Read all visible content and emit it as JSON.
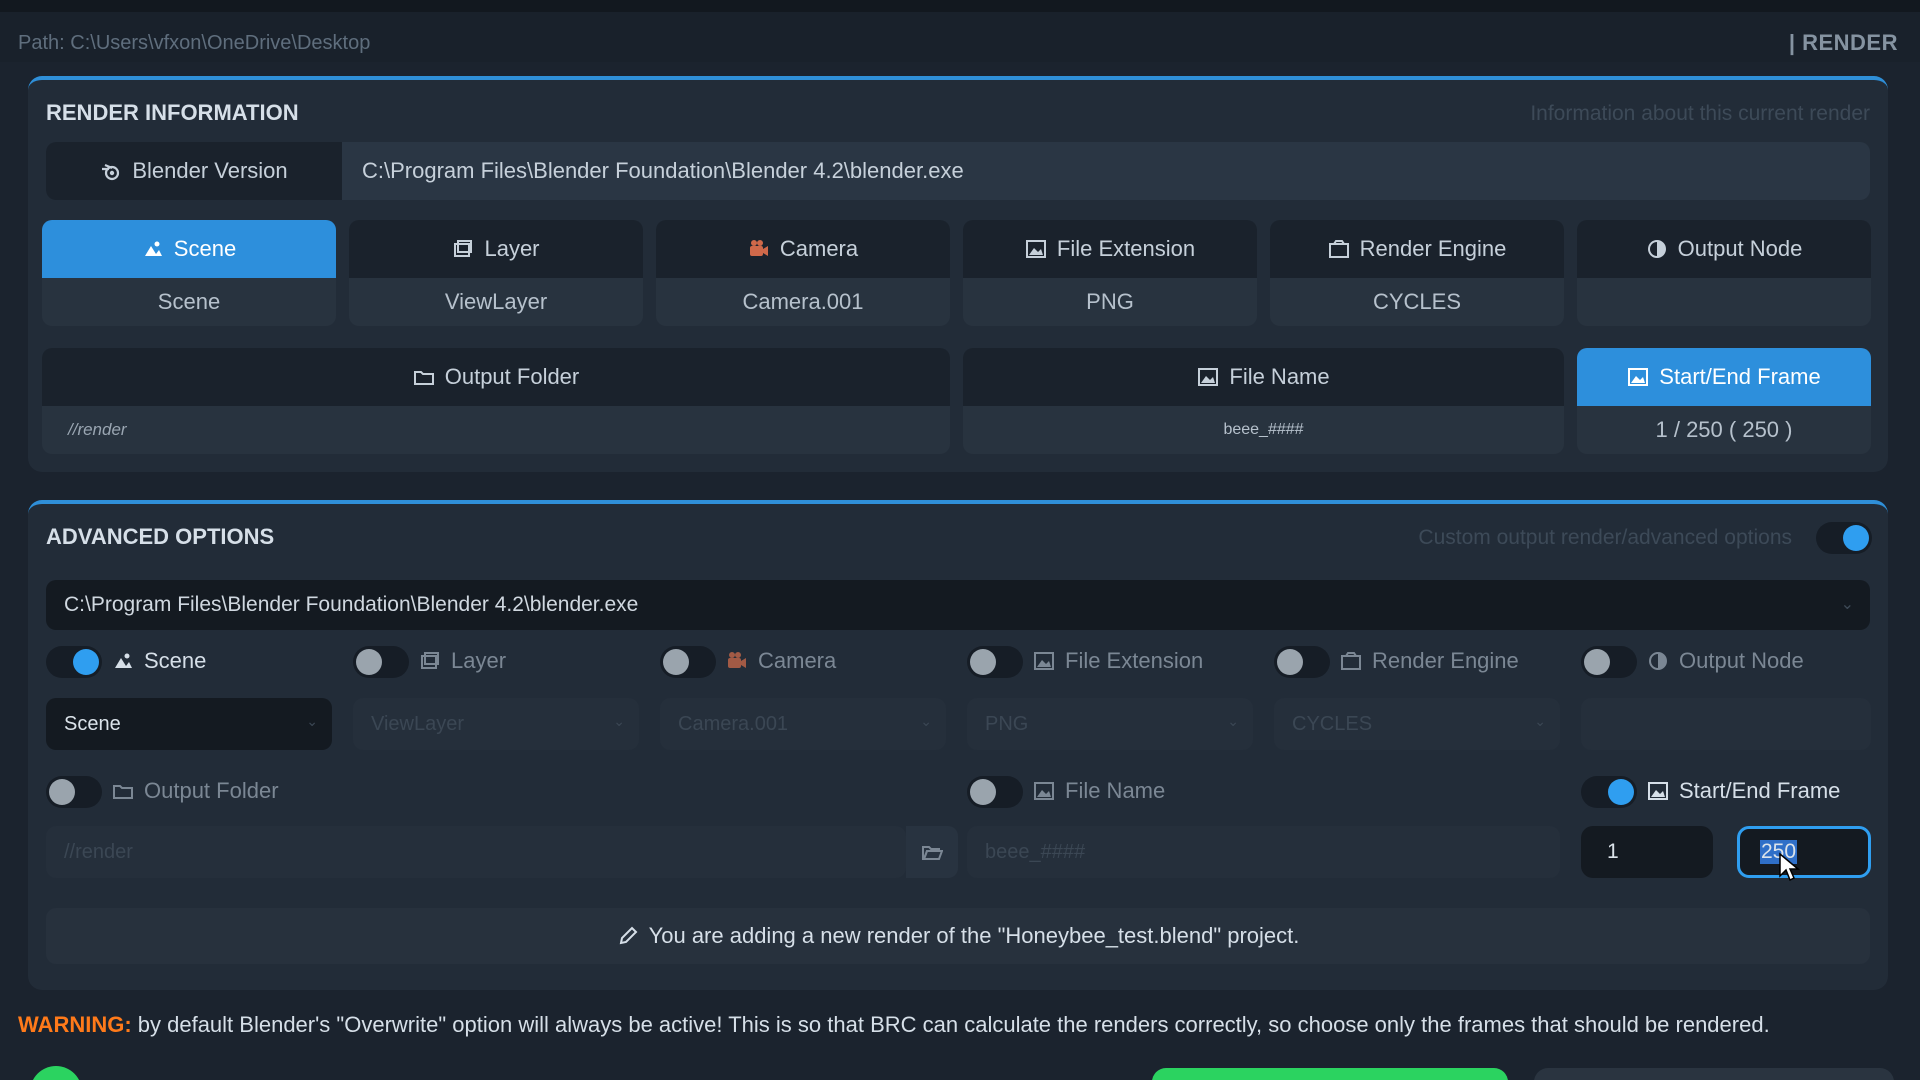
{
  "header": {
    "path": "Path: C:\\Users\\vfxon\\OneDrive\\Desktop",
    "section": "| RENDER"
  },
  "render_info": {
    "title": "RENDER INFORMATION",
    "subtitle": "Information about this current render",
    "version_label": "Blender Version",
    "version_path": "C:\\Program Files\\Blender Foundation\\Blender 4.2\\blender.exe",
    "cards": [
      {
        "label": "Scene",
        "value": "Scene",
        "icon": "scene-icon",
        "active": true
      },
      {
        "label": "Layer",
        "value": "ViewLayer",
        "icon": "layer-icon",
        "active": false
      },
      {
        "label": "Camera",
        "value": "Camera.001",
        "icon": "camera-icon",
        "active": false
      },
      {
        "label": "File Extension",
        "value": "PNG",
        "icon": "image-icon",
        "active": false
      },
      {
        "label": "Render Engine",
        "value": "CYCLES",
        "icon": "render-engine-icon",
        "active": false
      },
      {
        "label": "Output Node",
        "value": "",
        "icon": "output-node-icon",
        "active": false
      }
    ],
    "output_folder": {
      "label": "Output Folder",
      "value": "//render"
    },
    "file_name": {
      "label": "File Name",
      "value": "beee_####"
    },
    "frames": {
      "label": "Start/End Frame",
      "value": "1 / 250 ( 250 )"
    }
  },
  "advanced": {
    "title": "ADVANCED OPTIONS",
    "subtitle": "Custom output render/advanced options",
    "toggle_on": true,
    "blender_path": "C:\\Program Files\\Blender Foundation\\Blender 4.2\\blender.exe",
    "options": [
      {
        "label": "Scene",
        "on": true,
        "value": "Scene"
      },
      {
        "label": "Layer",
        "on": false,
        "value": "ViewLayer"
      },
      {
        "label": "Camera",
        "on": false,
        "value": "Camera.001"
      },
      {
        "label": "File Extension",
        "on": false,
        "value": "PNG"
      },
      {
        "label": "Render Engine",
        "on": false,
        "value": "CYCLES"
      },
      {
        "label": "Output Node",
        "on": false,
        "value": ""
      }
    ],
    "output_folder": {
      "label": "Output Folder",
      "on": false,
      "placeholder": "//render"
    },
    "file_name": {
      "label": "File Name",
      "on": false,
      "placeholder": "beee_####"
    },
    "frames": {
      "label": "Start/End Frame",
      "on": true,
      "start": "1",
      "end": "250"
    },
    "info_message": "You are adding a new render of the \"Honeybee_test.blend\" project."
  },
  "warning": {
    "prefix": "WARNING:",
    "text": " by default Blender's \"Overwrite\" option will always be active! This is so that BRC can calculate the renders correctly, so choose only the frames that should be rendered."
  },
  "colors": {
    "accent": "#2d8fdc",
    "toggle_on": "#2f9ef0",
    "warning": "#ff7a1a",
    "success": "#2bd360"
  }
}
